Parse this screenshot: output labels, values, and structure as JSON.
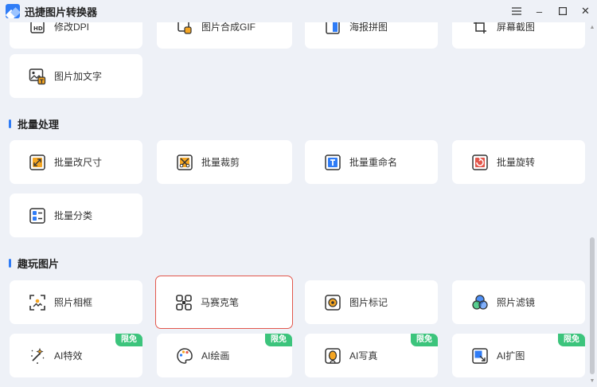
{
  "window": {
    "title": "迅捷图片转换器",
    "minimize": "–",
    "restore": "⧉",
    "maximize": "☐",
    "close": "✕"
  },
  "top_partial": [
    {
      "label": "修改DPI",
      "icon": "hd-icon"
    },
    {
      "label": "图片合成GIF",
      "icon": "gif-icon"
    },
    {
      "label": "海报拼图",
      "icon": "collage-icon"
    },
    {
      "label": "屏幕截图",
      "icon": "screenshot-icon"
    }
  ],
  "top_extra": {
    "label": "图片加文字",
    "icon": "image-text-icon"
  },
  "sections": {
    "batch": {
      "title": "批量处理",
      "items": [
        {
          "label": "批量改尺寸",
          "icon": "resize-icon"
        },
        {
          "label": "批量裁剪",
          "icon": "crop-icon"
        },
        {
          "label": "批量重命名",
          "icon": "rename-icon"
        },
        {
          "label": "批量旋转",
          "icon": "rotate-icon"
        },
        {
          "label": "批量分类",
          "icon": "classify-icon"
        }
      ]
    },
    "fun": {
      "title": "趣玩图片",
      "items": [
        {
          "label": "照片相框",
          "icon": "frame-icon"
        },
        {
          "label": "马赛克笔",
          "icon": "mosaic-icon"
        },
        {
          "label": "图片标记",
          "icon": "mark-icon"
        },
        {
          "label": "照片滤镜",
          "icon": "filter-icon"
        },
        {
          "label": "AI特效",
          "icon": "ai-effect-icon",
          "badge": "限免"
        },
        {
          "label": "AI绘画",
          "icon": "ai-paint-icon",
          "badge": "限免"
        },
        {
          "label": "AI写真",
          "icon": "ai-portrait-icon",
          "badge": "限免"
        },
        {
          "label": "AI扩图",
          "icon": "ai-expand-icon",
          "badge": "限免"
        }
      ]
    }
  },
  "colors": {
    "accent": "#2f7cf6",
    "icon_orange": "#f5a623",
    "badge_green": "#3cc47c",
    "selection_red": "#e2574c",
    "background": "#eef1f7"
  }
}
